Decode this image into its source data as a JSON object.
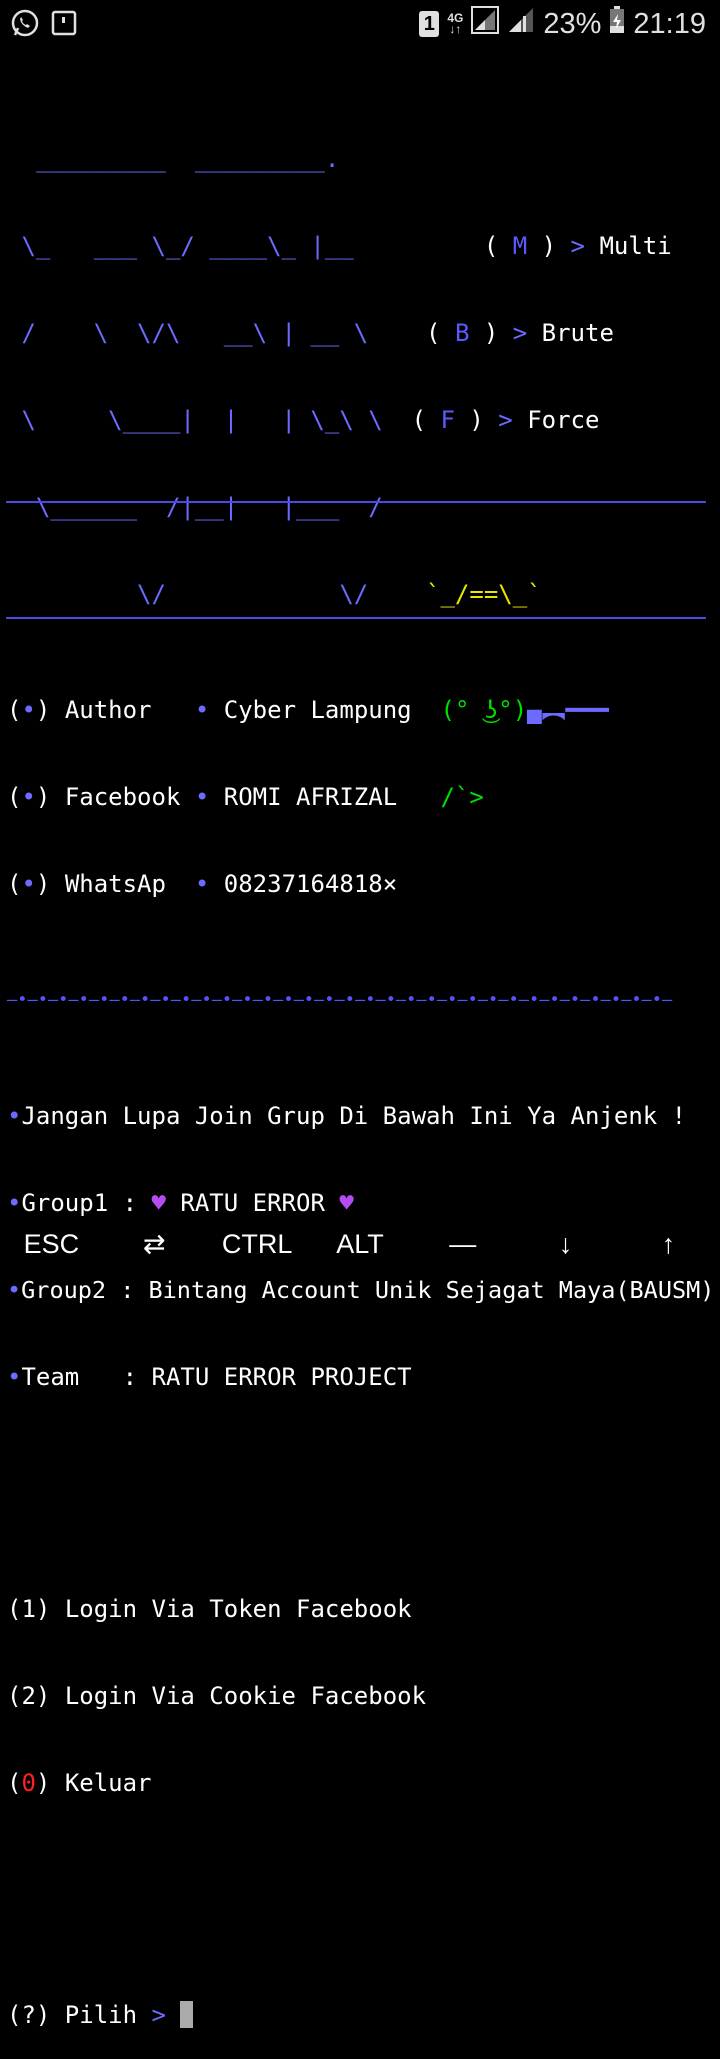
{
  "statusbar": {
    "sim": "1",
    "net_top": "4G",
    "net_bottom": "↓↑",
    "battery": "23%",
    "time": "21:19"
  },
  "banner": {
    "art": [
      "  _________  _________.",
      " \\_   ___ \\_/ ____\\_ |__",
      " /    \\  \\/\\   __\\ | __ \\",
      " \\     \\____|  |   | \\_\\ \\",
      "  \\______  /|__|   |___  /",
      "         \\/            \\/"
    ],
    "menu": [
      {
        "letter": "M",
        "word": "Multi"
      },
      {
        "letter": "B",
        "word": "Brute"
      },
      {
        "letter": "F",
        "word": "Force"
      }
    ],
    "face_top": "`_/==\\_`",
    "face_mid": "(° ͜ʖ°)",
    "face_bottom": "/`>"
  },
  "info": [
    {
      "label": "Author",
      "value": "Cyber Lampung"
    },
    {
      "label": "Facebook",
      "value": "ROMI AFRIZAL"
    },
    {
      "label": "WhatsAp",
      "value": "08237164818×"
    }
  ],
  "separator1": "—•—•—•—•—•—•—•—•—•—•—•—•—•—•—•—•—•—•—•—•—•—•—•—•—•—•—•—•—•—•—•—•—",
  "notice": {
    "line1": "Jangan Lupa Join Grup Di Bawah Ini Ya Anjenk !",
    "group1_label": "Group1 : ",
    "group1_value": "RATU ERROR",
    "group2_label": "Group2 : ",
    "group2_value": "Bintang Account Unik Sejagat Maya(BAUSM)",
    "team_label": "Team   : ",
    "team_value": "RATU ERROR PROJECT"
  },
  "menu_options": [
    {
      "num": "1",
      "label": "Login Via Token Facebook"
    },
    {
      "num": "2",
      "label": "Login Via Cookie Facebook"
    },
    {
      "num": "0",
      "label": "Keluar"
    }
  ],
  "prompt": {
    "prefix": "(?) Pilih ",
    "arrow": ">"
  },
  "extra_keys": [
    "ESC",
    "⇄",
    "CTRL",
    "ALT",
    "—",
    "↓",
    "↑"
  ]
}
